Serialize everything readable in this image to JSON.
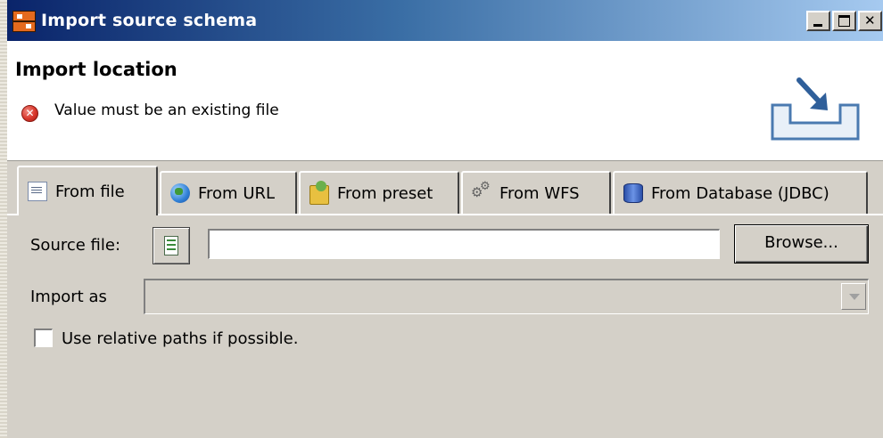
{
  "window": {
    "title": "Import source schema",
    "minimize_icon": "minimize-icon",
    "maximize_icon": "maximize-icon",
    "close_icon": "close-icon"
  },
  "banner": {
    "title": "Import location",
    "error_icon": "error-icon",
    "error_message": "Value must be an existing file",
    "graphic_icon": "import-wizard-graphic"
  },
  "tabs": [
    {
      "label": "From file",
      "icon": "file-icon",
      "active": true
    },
    {
      "label": "From URL",
      "icon": "globe-icon",
      "active": false
    },
    {
      "label": "From preset",
      "icon": "folder-icon",
      "active": false
    },
    {
      "label": "From WFS",
      "icon": "gears-icon",
      "active": false
    },
    {
      "label": "From Database (JDBC)",
      "icon": "database-icon",
      "active": false
    }
  ],
  "form": {
    "source_file_label": "Source file:",
    "source_file_value": "",
    "browse_label": "Browse...",
    "import_as_label": "Import as",
    "import_as_value": "",
    "relative_paths_label": "Use relative paths if possible.",
    "relative_paths_checked": false
  },
  "colors": {
    "titlebar_start": "#0a246a",
    "titlebar_end": "#a6caf0",
    "dialog_face": "#d4d0c8",
    "error_red": "#d9362b"
  }
}
